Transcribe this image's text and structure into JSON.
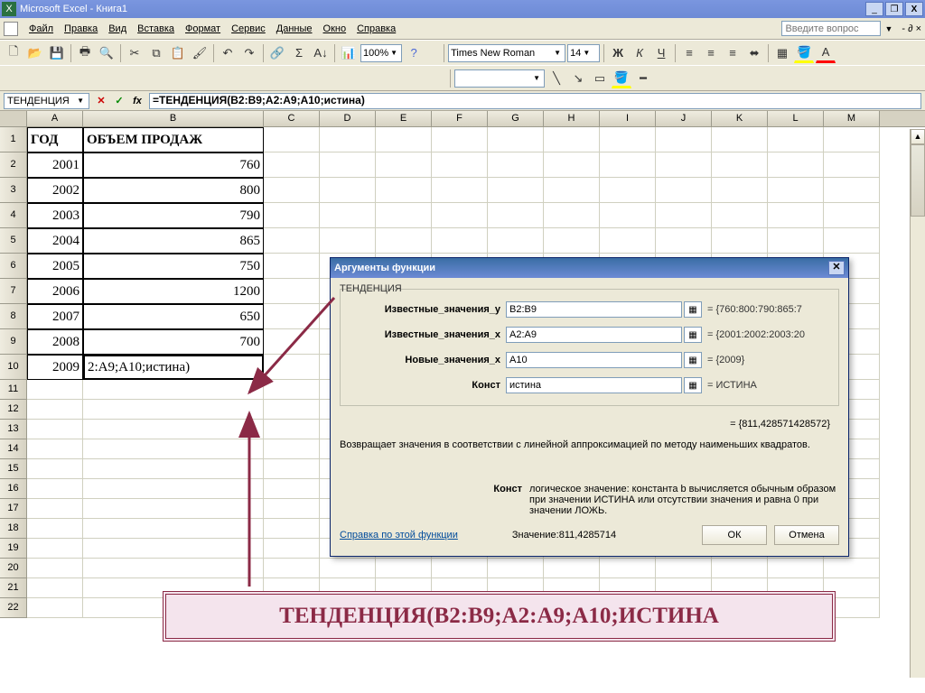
{
  "window": {
    "title": "Microsoft Excel - Книга1",
    "min": "_",
    "restore": "❐",
    "close": "X"
  },
  "menu": {
    "file": "Файл",
    "edit": "Правка",
    "view": "Вид",
    "insert": "Вставка",
    "format": "Формат",
    "service": "Сервис",
    "data": "Данные",
    "window": "Окно",
    "help": "Справка",
    "help_search_placeholder": "Введите вопрос"
  },
  "toolbar": {
    "zoom": "100%",
    "font": "Times New Roman",
    "size": "14"
  },
  "formula_bar": {
    "name_box": "ТЕНДЕНЦИЯ",
    "formula": "=ТЕНДЕНЦИЯ(B2:B9;A2:A9;A10;истина)"
  },
  "sheet": {
    "columns": [
      "A",
      "B",
      "C",
      "D",
      "E",
      "F",
      "G",
      "H",
      "I",
      "J",
      "K",
      "L",
      "M"
    ],
    "row_count": 22,
    "headers": {
      "A1": "ГОД",
      "B1": "ОБЪЕМ ПРОДАЖ"
    },
    "data": [
      {
        "year": "2001",
        "sales": "760"
      },
      {
        "year": "2002",
        "sales": "800"
      },
      {
        "year": "2003",
        "sales": "790"
      },
      {
        "year": "2004",
        "sales": "865"
      },
      {
        "year": "2005",
        "sales": "750"
      },
      {
        "year": "2006",
        "sales": "1200"
      },
      {
        "year": "2007",
        "sales": "650"
      },
      {
        "year": "2008",
        "sales": "700"
      }
    ],
    "row10_A": "2009",
    "row10_B": "2:A9;A10;истина)"
  },
  "dialog": {
    "title": "Аргументы функции",
    "fieldset": "ТЕНДЕНЦИЯ",
    "args": {
      "y_label": "Известные_значения_y",
      "y_value": "B2:B9",
      "y_result": "= {760:800:790:865:7",
      "x_label": "Известные_значения_x",
      "x_value": "A2:A9",
      "x_result": "= {2001:2002:2003:20",
      "newx_label": "Новые_значения_x",
      "newx_value": "A10",
      "newx_result": "= {2009}",
      "const_label": "Конст",
      "const_value": "истина",
      "const_result": "= ИСТИНА"
    },
    "overall_result": "= {811,428571428572}",
    "desc": "Возвращает значения в соответствии с линейной аппроксимацией по методу наименьших квадратов.",
    "arg_desc_label": "Конст",
    "arg_desc_body": "логическое значение: константа b вычисляется обычным образом при значении ИСТИНА или отсутствии значения и равна 0 при значении ЛОЖЬ.",
    "link": "Справка по этой функции",
    "value_label": "Значение:",
    "value": "811,4285714",
    "ok": "ОК",
    "cancel": "Отмена"
  },
  "callout": "ТЕНДЕНЦИЯ(B2:B9;A2:A9;A10;ИСТИНА"
}
